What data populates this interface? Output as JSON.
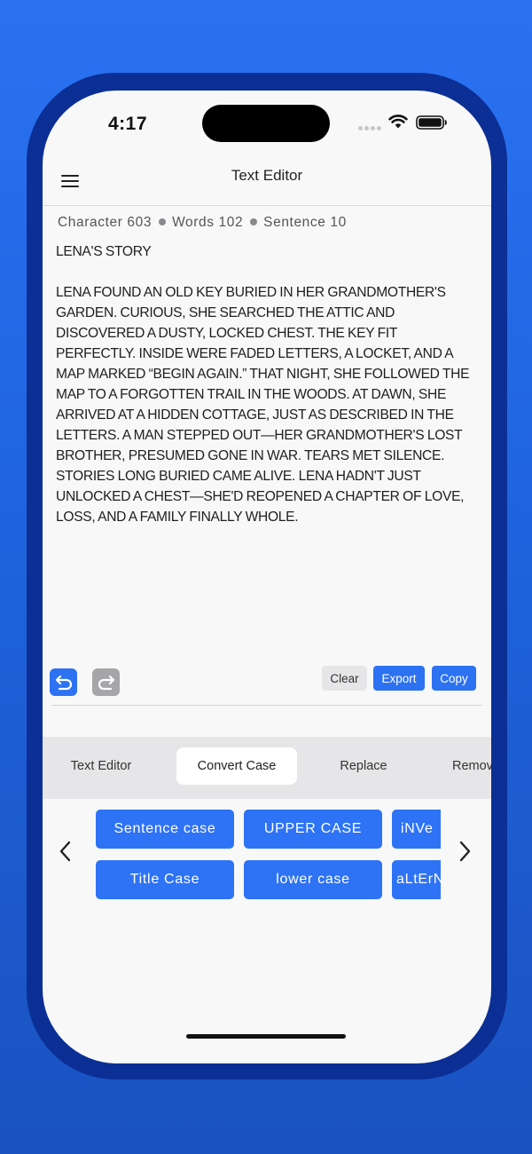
{
  "status_bar": {
    "time": "4:17"
  },
  "header": {
    "title": "Text Editor"
  },
  "stats": {
    "character_label": "Character",
    "character_count": "603",
    "words_label": "Words",
    "words_count": "102",
    "sentence_label": "Sentence",
    "sentence_count": "10"
  },
  "editor": {
    "content": "LENA'S STORY\n\nLENA FOUND AN OLD KEY BURIED IN HER GRANDMOTHER'S GARDEN. CURIOUS, SHE SEARCHED THE ATTIC AND DISCOVERED A DUSTY, LOCKED CHEST. THE KEY FIT PERFECTLY. INSIDE WERE FADED LETTERS, A LOCKET, AND A MAP MARKED “BEGIN AGAIN.” THAT NIGHT, SHE FOLLOWED THE MAP TO A FORGOTTEN TRAIL IN THE WOODS. AT DAWN, SHE ARRIVED AT A HIDDEN COTTAGE, JUST AS DESCRIBED IN THE LETTERS. A MAN STEPPED OUT—HER GRANDMOTHER'S LOST BROTHER, PRESUMED GONE IN WAR. TEARS MET SILENCE. STORIES LONG BURIED CAME ALIVE. LENA HADN'T JUST UNLOCKED A CHEST—SHE'D REOPENED A CHAPTER OF LOVE, LOSS, AND A FAMILY FINALLY WHOLE."
  },
  "toolbar": {
    "clear_label": "Clear",
    "export_label": "Export",
    "copy_label": "Copy"
  },
  "tabs": [
    {
      "label": "Text Editor",
      "active": false
    },
    {
      "label": "Convert Case",
      "active": true
    },
    {
      "label": "Replace",
      "active": false
    },
    {
      "label": "Remov",
      "active": false
    }
  ],
  "case_actions": {
    "row1": [
      "Sentence case",
      "UPPER CASE",
      "iNVe"
    ],
    "row2": [
      "Title Case",
      "lower case",
      "aLtErN"
    ]
  },
  "colors": {
    "accent": "#2e73f5",
    "background": "#2a72f2",
    "frame": "#0b2f95"
  }
}
